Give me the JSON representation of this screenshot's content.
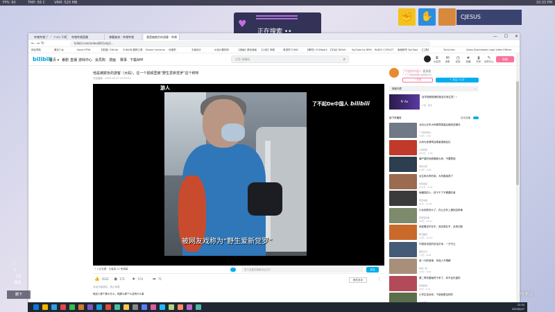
{
  "overlay": {
    "stats": [
      "FPS: 60",
      "TMP: 56 C",
      "VRM: 520 MB"
    ],
    "clock": "10:33 PM",
    "searching_text": "正在搜索 ••",
    "streamer_name": "CJESUS",
    "left_text": [
      "[",
      "1",
      "【3]",
      "蒲酒"
    ],
    "left_button": "撤下",
    "right_text": "时测试"
  },
  "browser": {
    "tabs": [
      "哔哩哔哩 (゜-゜)つ口 干杯",
      "哔哩哔哩直播",
      "弹幕查询 - 哔哩哔哩",
      "我是被欺负的游客 - 哔哩"
    ],
    "window_controls": [
      "—",
      "☐",
      "✕"
    ],
    "nav_icons": [
      "←",
      "→",
      "↻"
    ],
    "url": "bilibili.com/video/BV1a4y1…",
    "bookmarks": [
      "网址导航",
      "魔法少女",
      "Nova HTML",
      "【前端】GitHub",
      "YUNXIN 魔神工具",
      "Steam Universe",
      "动漫吧",
      "平面设计",
      "AI设计素材网",
      "【漫画】原创漫画",
      "【小说】网络",
      "英语学习 BBC",
      "【素材】ICONpark",
      "【平台】Bilibili",
      "YouTube by BRM",
      "RADIO COPILOT",
      "饭碗研究 YouTube",
      "【工具】",
      "TechLinks",
      "Video Downloader",
      "Logo Video Effects"
    ]
  },
  "bili": {
    "logo": "bilibili",
    "nav": [
      "首页 ▾",
      "番剧",
      "直播",
      "游戏中心",
      "会员购",
      "漫画",
      "赛事",
      "下载APP"
    ],
    "search_placeholder": "抖音 弹幕网",
    "right_icons": [
      {
        "icon": "♛",
        "label": "大会员"
      },
      {
        "icon": "✉",
        "label": "消息"
      },
      {
        "icon": "◷",
        "label": "动态"
      },
      {
        "icon": "★",
        "label": "收藏"
      },
      {
        "icon": "⧗",
        "label": "历史"
      },
      {
        "icon": "✎",
        "label": "创作中心"
      }
    ],
    "upload": "投稿"
  },
  "video": {
    "title": "他是被欺负的游客（大妈），在一个视频里被“野生爱新觉罗”这个称呼",
    "meta": "已经播放 · 2023-05-07 21:59:31",
    "top_caption": "游人",
    "watermark": "了不起De中国人",
    "watermark_logo": "bilibili",
    "subtitle": "被网友戏称为“野生爱新觉罗”",
    "danmaku_count": "7 人正在看 · 已装填 22 条弹幕",
    "danmaku_placeholder": "发个友善的弹幕见证当下",
    "send": "发送",
    "actions": [
      {
        "icon": "👍",
        "label": "3522"
      },
      {
        "icon": "◉",
        "label": "171"
      },
      {
        "icon": "★",
        "label": "574"
      },
      {
        "icon": "➦",
        "label": "71"
      }
    ],
    "report": "稿件投诉",
    "more": "⋮",
    "desc1": "未经作者授权，禁止转载",
    "desc2": "他这人那个那么什么，他那么那个么没有什么事"
  },
  "sidebar": {
    "up_name": "了不起的中国人",
    "up_badge": "发消息",
    "up_desc": "一个了不起的中国人的视频分享",
    "charge": "⚡ 充电",
    "follow": "+ 关注 3.1万",
    "danmaku_list": "弹幕列表",
    "danmaku_arrow": "⌄",
    "ad_thumb": "Pr  Ae",
    "ad_title": "自学视频剪辑的朋友们请注意！！",
    "ad_meta": "广告 · 知乎",
    "autoplay": "接下来播放",
    "autoplay_label": "自动连播",
    "recs": [
      {
        "title": "北京公交车大妈辱骂乘客后被网友曝光",
        "author": "了不起中国人",
        "stats": "3.9万 · 2-21"
      },
      {
        "title": "大妈为老婆骂战乘客视频走红",
        "author": "小葵视频",
        "stats": "18.5万 · 3-18"
      },
      {
        "title": "最严重的地铁霸座大妈，不要惹她",
        "author": "城市见闻",
        "stats": "5.3万 · 1-26"
      },
      {
        "title": "女生和大妈吵架，大妈直接哭了",
        "author": "新闻速递",
        "stats": "12.1万 · 4-02"
      },
      {
        "title": "他嘲笑的人，终于干了不需要的事",
        "author": "老张说事",
        "stats": "21万 · 11-09"
      },
      {
        "title": "小伙到底怎么了，在公交车上遇到这种事",
        "author": "有意思的事",
        "stats": "9.8万 · 10-11"
      },
      {
        "title": "他笑着说不在乎，其实很在乎，全场沉默",
        "author": "每日趣闻",
        "stats": "4.4万 · 12-23"
      },
      {
        "title": "中国老百姓的说话艺术，一方不让",
        "author": "国民日记",
        "stats": "7.2万 · 8-30"
      },
      {
        "title": "老一代的故事，年轻人不理解",
        "author": "情感一线",
        "stats": "2.6万 · 9-15"
      },
      {
        "title": "第二季完整版终于来了，你不会失望的",
        "author": "视频集锦",
        "stats": "31万 · 5-07"
      },
      {
        "title": "小学生告诉你，干部就是这样的",
        "author": "小葵视频",
        "stats": "6.1万 · 6-12"
      }
    ],
    "rec_colors": [
      "#6f7a86",
      "#c0392b",
      "#2c3e50",
      "#9b6b4f",
      "#3b3b3b",
      "#7d8a6b",
      "#c96a2b",
      "#445b78",
      "#a78f7a",
      "#b34a5a",
      "#5b6f4a"
    ]
  },
  "taskbar": {
    "time": "22:33",
    "date": "2023/5/27",
    "icon_colors": [
      "#0a78d7",
      "#f4b400",
      "#30a0e0",
      "#e04848",
      "#3fb950",
      "#d07a2d",
      "#7a58c6",
      "#1e9bd7",
      "#dd4b39",
      "#44c1a1",
      "#f7c948",
      "#888888",
      "#5b7cfa",
      "#e05d9b",
      "#29b6f6",
      "#aed581",
      "#ff8a65",
      "#ba68c8",
      "#4db6ac"
    ]
  }
}
